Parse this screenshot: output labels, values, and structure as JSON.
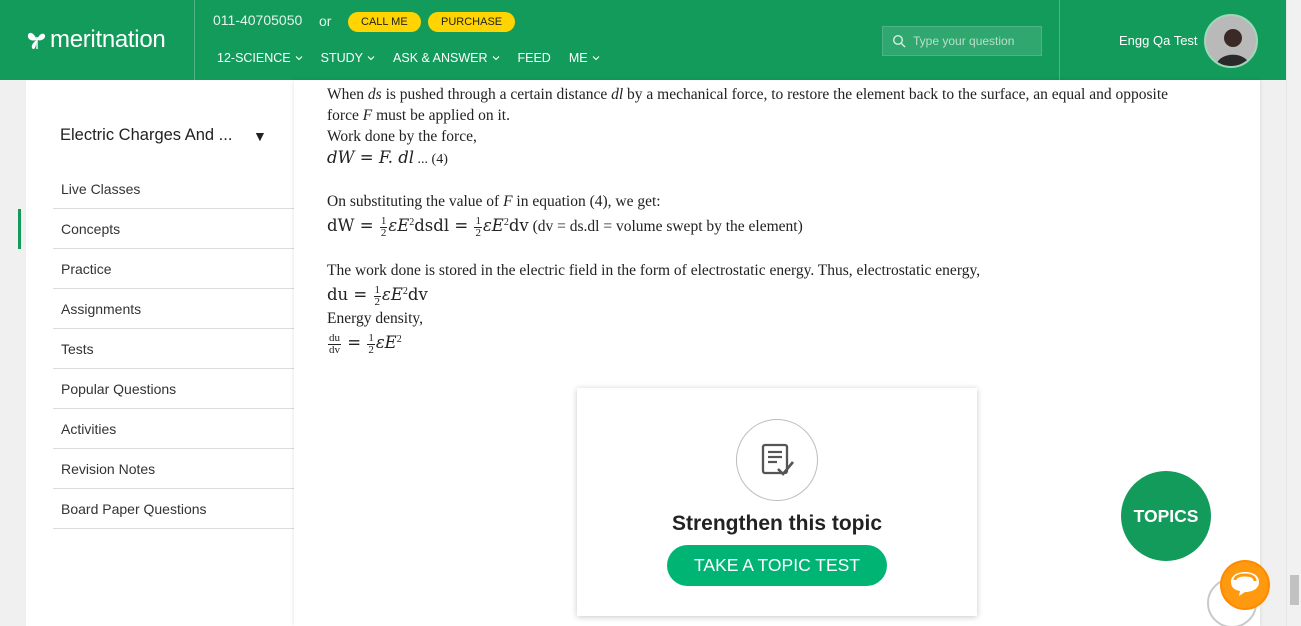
{
  "header": {
    "logo_text": "meritnation",
    "phone": "011-40705050",
    "or_text": "or",
    "call_me_label": "CALL ME",
    "purchase_label": "PURCHASE",
    "nav": [
      {
        "label": "12-SCIENCE",
        "icon": "chevron-down-icon"
      },
      {
        "label": "STUDY",
        "icon": "chevron-down-icon"
      },
      {
        "label": "ASK & ANSWER",
        "icon": "chevron-down-icon"
      },
      {
        "label": "FEED"
      },
      {
        "label": "ME",
        "icon": "chevron-down-icon"
      }
    ],
    "search_placeholder": "Type your question",
    "user_name": "Engg Qa Test"
  },
  "sidebar": {
    "chapter_title": "Electric Charges And ...",
    "chapter_caret": "▼",
    "items": [
      {
        "label": "Live Classes"
      },
      {
        "label": "Concepts",
        "active": true
      },
      {
        "label": "Practice"
      },
      {
        "label": "Assignments"
      },
      {
        "label": "Tests"
      },
      {
        "label": "Popular Questions"
      },
      {
        "label": "Activities"
      },
      {
        "label": "Revision Notes"
      },
      {
        "label": "Board Paper Questions"
      }
    ]
  },
  "content": {
    "para1_a": "When ",
    "para1_ds": "ds",
    "para1_b": " is pushed through a certain distance ",
    "para1_dl": "dl",
    "para1_c": " by a mechanical force, to restore the element back to the surface, an equal and opposite",
    "para1_d": "force ",
    "para1_F": "F",
    "para1_e": " must be applied on it.",
    "work_label": "Work done by the force,",
    "eq4": "dW = F. dl",
    "eq4_tag": " ... (4)",
    "subst_a": "On substituting the value of ",
    "subst_F": "F",
    "subst_b": " in equation (4), we get:",
    "eq5_a": "dW = ",
    "eq5_b": "εE",
    "eq5_c": "dsdl  = ",
    "eq5_d": "εE",
    "eq5_e": "dv",
    "eq5_note": "   (dv = ds.dl = volume swept by the element)",
    "stored_text": "The work done is stored in the electric field in the form of electrostatic energy. Thus, electrostatic energy,",
    "eq6_a": "du = ",
    "eq6_b": "εE",
    "eq6_c": "dv",
    "density_label": "Energy density,",
    "eq7_num": "du",
    "eq7_den": "dv",
    "eq7_b": " = ",
    "eq7_c": "εE",
    "half_num": "1",
    "half_den": "2",
    "sq": "2"
  },
  "card": {
    "icon": "document-check-icon",
    "title": "Strengthen this topic",
    "button_label": "TAKE A TOPIC TEST"
  },
  "floating": {
    "topics_label": "TOPICS",
    "chat_icon": "chat-bubble-icon"
  },
  "colors": {
    "brand_green": "#139b5c",
    "button_green": "#00b573",
    "pill_yellow": "#ffd400",
    "chat_orange": "#ff8a00"
  }
}
